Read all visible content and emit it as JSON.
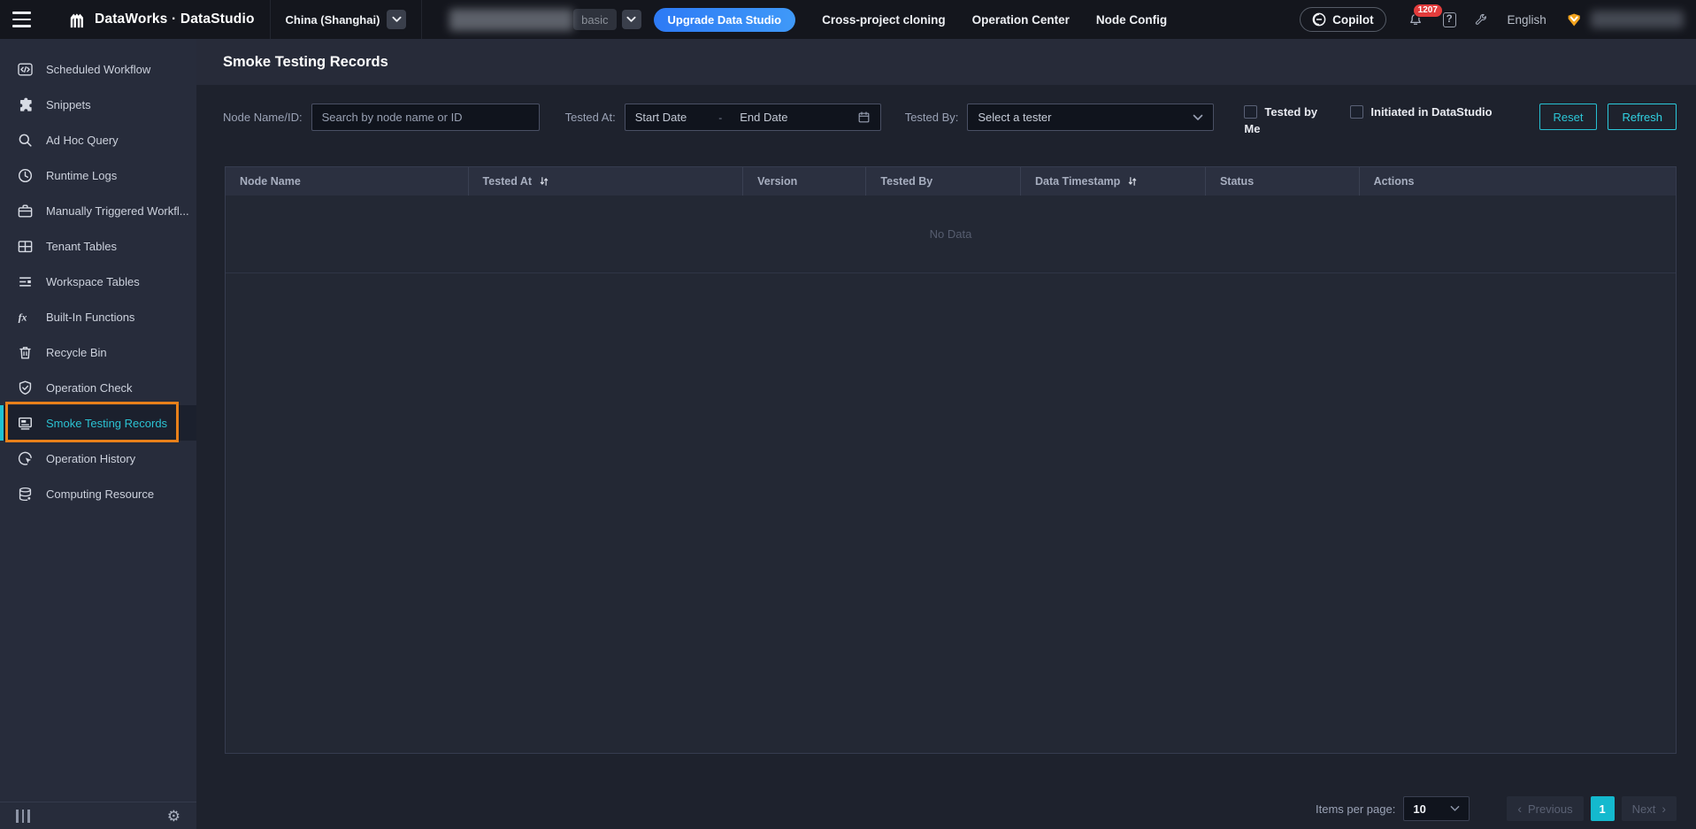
{
  "topbar": {
    "brand": "DataWorks · DataStudio",
    "region": "China (Shanghai)",
    "env_label": "basic",
    "upgrade_label": "Upgrade Data Studio",
    "nav": [
      "Cross-project cloning",
      "Operation Center",
      "Node Config"
    ],
    "copilot_label": "Copilot",
    "notification_count": "1207",
    "help_glyph": "?",
    "language": "English"
  },
  "sidebar": {
    "items": [
      {
        "label": "Scheduled Workflow",
        "icon": "code-icon"
      },
      {
        "label": "Snippets",
        "icon": "puzzle-icon"
      },
      {
        "label": "Ad Hoc Query",
        "icon": "search-icon"
      },
      {
        "label": "Runtime Logs",
        "icon": "clock-icon"
      },
      {
        "label": "Manually Triggered Workfl...",
        "icon": "briefcase-icon"
      },
      {
        "label": "Tenant Tables",
        "icon": "table-icon"
      },
      {
        "label": "Workspace Tables",
        "icon": "list-icon"
      },
      {
        "label": "Built-In Functions",
        "icon": "fx-icon"
      },
      {
        "label": "Recycle Bin",
        "icon": "trash-icon"
      },
      {
        "label": "Operation Check",
        "icon": "shield-check-icon"
      },
      {
        "label": "Smoke Testing Records",
        "icon": "document-icon",
        "active": true
      },
      {
        "label": "Operation History",
        "icon": "history-cursor-icon"
      },
      {
        "label": "Computing Resource",
        "icon": "database-icon"
      }
    ]
  },
  "page": {
    "title": "Smoke Testing Records"
  },
  "filters": {
    "node_name_label": "Node Name/ID:",
    "node_name_placeholder": "Search by node name or ID",
    "tested_at_label": "Tested At:",
    "start_date_placeholder": "Start Date",
    "date_separator": "-",
    "end_date_placeholder": "End Date",
    "tested_by_label": "Tested By:",
    "tested_by_placeholder": "Select a tester",
    "checkbox_tested_by_me": "Tested by Me",
    "checkbox_initiated": "Initiated in DataStudio",
    "reset_label": "Reset",
    "refresh_label": "Refresh"
  },
  "table": {
    "columns": [
      {
        "label": "Node Name",
        "sortable": false
      },
      {
        "label": "Tested At",
        "sortable": true
      },
      {
        "label": "Version",
        "sortable": false
      },
      {
        "label": "Tested By",
        "sortable": false
      },
      {
        "label": "Data Timestamp",
        "sortable": true
      },
      {
        "label": "Status",
        "sortable": false
      },
      {
        "label": "Actions",
        "sortable": false
      }
    ],
    "empty_text": "No Data"
  },
  "pagination": {
    "items_per_page_label": "Items per page:",
    "items_per_page_value": "10",
    "previous_label": "Previous",
    "prev_arrow": "‹",
    "current_page": "1",
    "next_label": "Next",
    "next_arrow": "›"
  },
  "colors": {
    "accent_cyan": "#2bc2d2",
    "active_page_bg": "#14b9ce",
    "upgrade_blue": "#2d7af5",
    "annotation_orange": "#e8801a",
    "badge_red": "#e23c3c",
    "vip_gold": "#f2a31d",
    "topbar_bg": "#14161d",
    "sidebar_bg": "#272c3b",
    "main_bg": "#1e222d",
    "table_header_bg": "#2b3040"
  }
}
